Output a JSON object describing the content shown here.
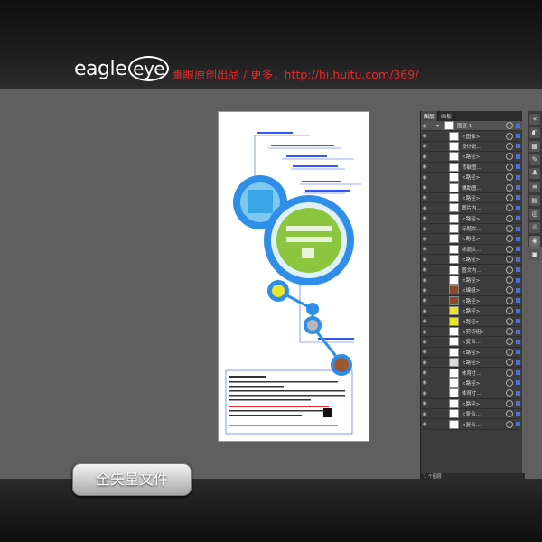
{
  "brand": {
    "name_left": "eagle",
    "name_right": "eye"
  },
  "headline": "鹰眼原创出品 / 更多，http://hi.huitu.com/369/",
  "panel": {
    "tabs": [
      {
        "label": "图层"
      },
      {
        "label": "画板"
      }
    ],
    "top_layer": "图层 1",
    "layers": [
      "<图像>",
      "设计说...",
      "<路径>",
      "背敏图...",
      "<路径>",
      "辅助图...",
      "<路径>",
      "图片内...",
      "<路径>",
      "标题文...",
      "<路径>",
      "标题文...",
      "<路径>",
      "图文内...",
      "<路径>",
      "<编组>",
      "<路径>",
      "<路径>",
      "<路径>",
      "<剪切组>",
      "<复合...",
      "<路径>",
      "<路径>",
      "体育寸...",
      "<路径>",
      "体育寸...",
      "<路径>",
      "<复合...",
      "<复合..."
    ],
    "footer": "1 个图层"
  },
  "doc": {
    "notes": [
      "此图下面部分，主体结构",
      "标题文字区域，文字排版可参考",
      "小提示",
      "图文内容区域",
      "素材",
      "说明"
    ],
    "bottom_lines": [
      "设计说明文字",
      "用法说明"
    ]
  },
  "badge": "全矢量文件"
}
